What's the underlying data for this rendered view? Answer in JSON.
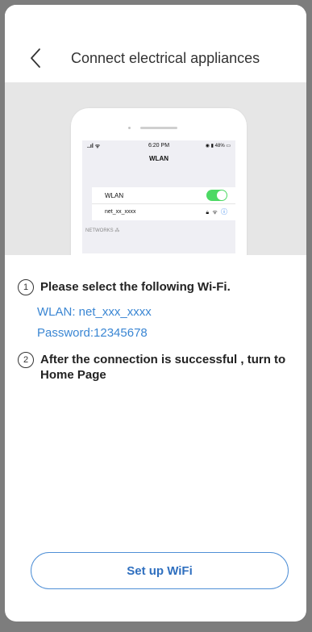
{
  "header": {
    "title": "Connect electrical appliances"
  },
  "phone_preview": {
    "status_signal": "..ıl ᯤ",
    "status_time": "6:20 PM",
    "status_battery": "◉ ▮ 48% ▭",
    "screen_title": "WLAN",
    "wlan_label": "WLAN",
    "wlan_on": true,
    "network_name": "net_xx_xxxx",
    "networks_label": "NETWORKS"
  },
  "steps": [
    {
      "number": "1",
      "text": "Please select the following Wi-Fi."
    },
    {
      "number": "2",
      "text": "After the connection is successful , turn to Home Page"
    }
  ],
  "wifi_info": {
    "wlan": "WLAN: net_xxx_xxxx",
    "password": "Password:12345678"
  },
  "button": {
    "label": "Set up WiFi"
  },
  "colors": {
    "accent": "#3a86d3",
    "toggle_green": "#4cd964",
    "background": "#7d7d7d"
  }
}
